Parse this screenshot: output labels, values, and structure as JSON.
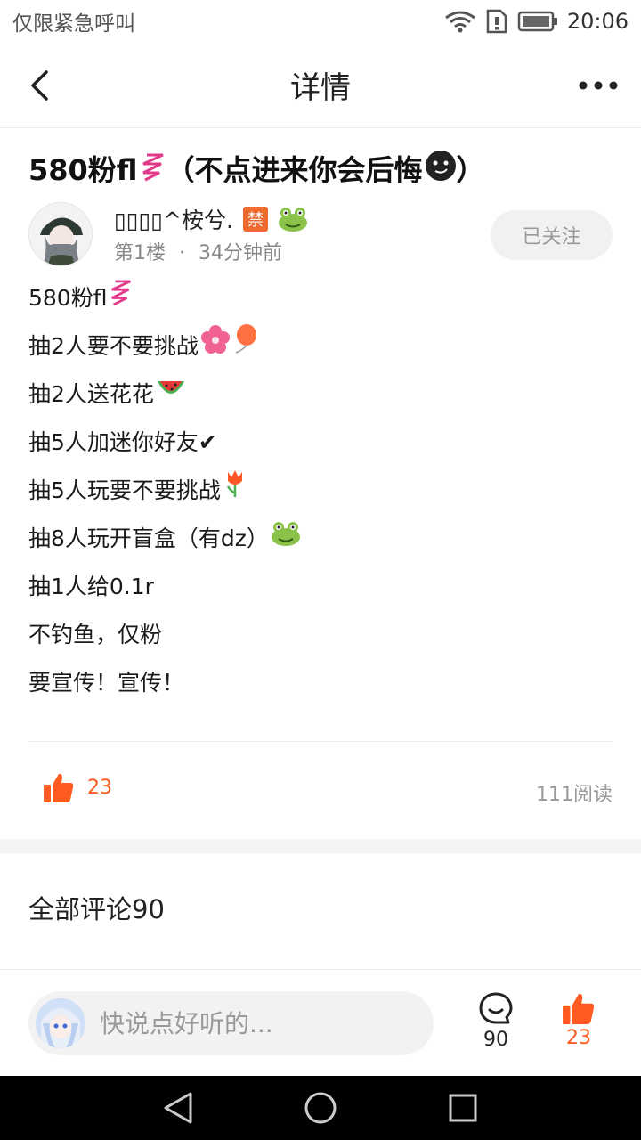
{
  "status_bar": {
    "carrier_text": "仅限紧急呼叫",
    "time": "20:06",
    "icons": [
      "wifi-icon",
      "sim-alert-icon",
      "battery-icon"
    ]
  },
  "header": {
    "title": "详情",
    "back_icon": "chevron-left-icon",
    "more_icon": "more-dots-icon"
  },
  "post": {
    "title": "580粉fl",
    "title_suffix": "（不点进来你会后悔",
    "title_end": "）",
    "author": {
      "name": "▯▯▯▯^桉兮.",
      "badges": [
        "禁",
        "frog-emoji"
      ]
    },
    "floor": "第1楼",
    "dot": "·",
    "time_ago": "34分钟前",
    "follow_label": "已关注",
    "lines": [
      "580粉fl",
      "抽2人要不要挑战",
      "抽2人送花花",
      "抽5人加迷你好友✔",
      "抽5人玩要不要挑战",
      "抽8人玩开盲盒（有dz）",
      "抽1人给0.1r",
      "不钓鱼，仅粉",
      "要宣传！宣传！"
    ],
    "like_count": "23",
    "read_count": "111阅读"
  },
  "comments": {
    "title": "全部评论90"
  },
  "bottom_bar": {
    "input_placeholder": "快说点好听的...",
    "comment_count": "90",
    "like_count": "23"
  },
  "colors": {
    "accent": "#ff5a1f",
    "text_primary": "#111111",
    "text_secondary": "#888888",
    "follow_bg": "#f1f1f1"
  }
}
